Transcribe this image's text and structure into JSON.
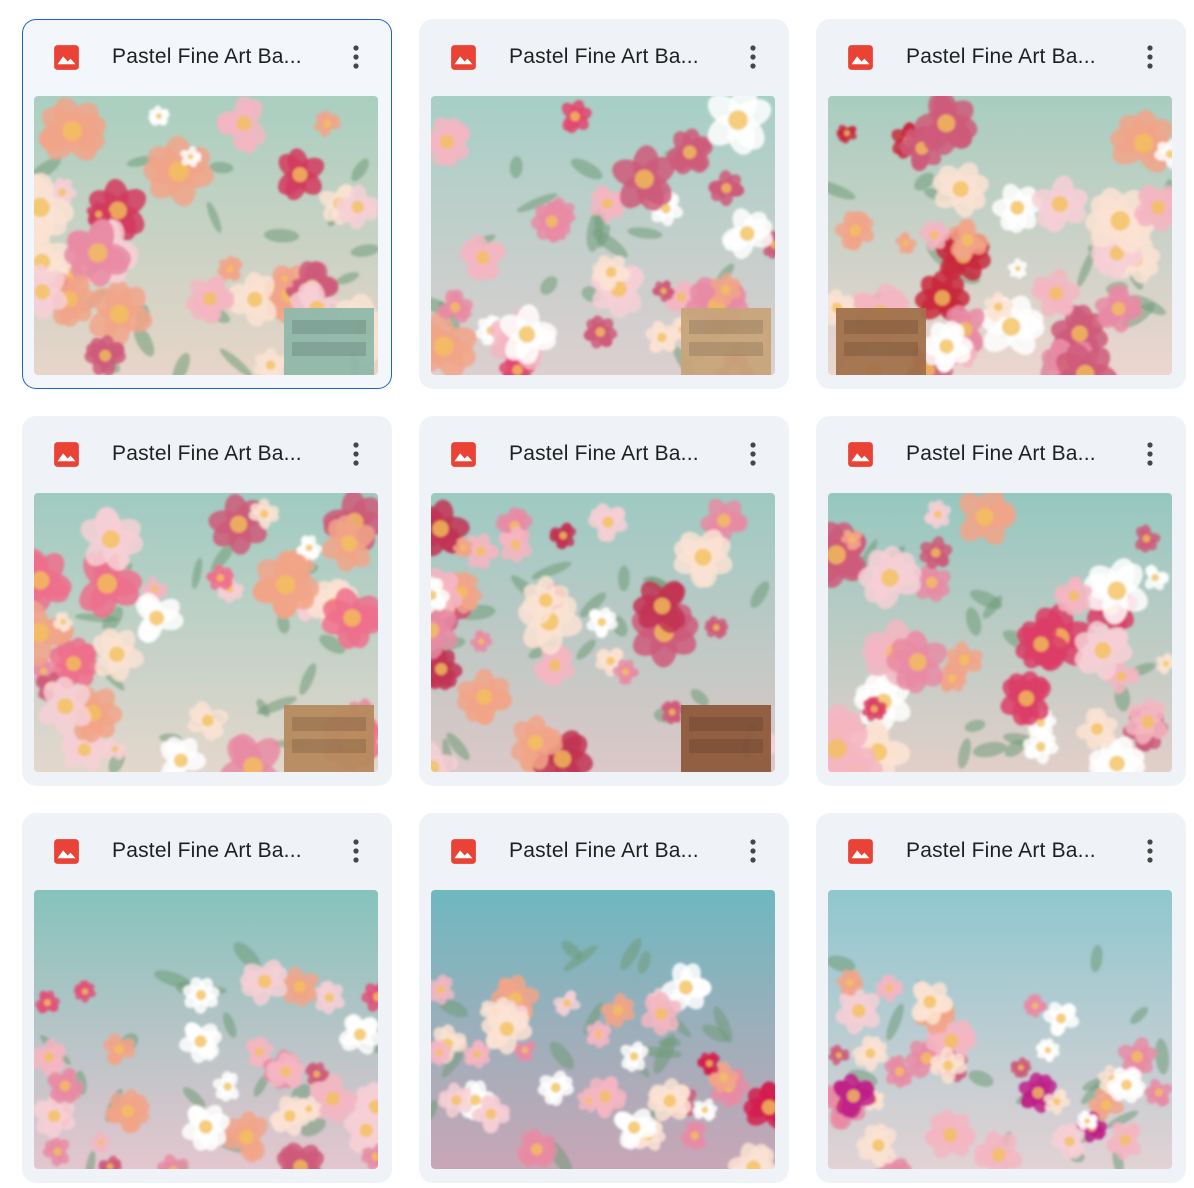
{
  "files": [
    {
      "title": "Pastel Fine Art Ba...",
      "selected": true,
      "bg": [
        "#a9cfc0",
        "#e7d5c8"
      ],
      "accent": "#d43a5e",
      "has_dresser": true,
      "dresser_color": "#8fb8ab"
    },
    {
      "title": "Pastel Fine Art Ba...",
      "selected": false,
      "bg": [
        "#a6cfc6",
        "#ddcfd0"
      ],
      "accent": "#e4456e",
      "has_dresser": true,
      "dresser_color": "#c7a47a"
    },
    {
      "title": "Pastel Fine Art Ba...",
      "selected": false,
      "bg": [
        "#a7cdbf",
        "#ecd6cf"
      ],
      "accent": "#c9283d",
      "has_dresser": true,
      "dresser_color": "#a0714a"
    },
    {
      "title": "Pastel Fine Art Ba...",
      "selected": false,
      "bg": [
        "#9fcbc1",
        "#e4d7cc"
      ],
      "accent": "#ef6f8c",
      "has_dresser": true,
      "dresser_color": "#b68a5e"
    },
    {
      "title": "Pastel Fine Art Ba...",
      "selected": false,
      "bg": [
        "#9dcac2",
        "#dcc8c8"
      ],
      "accent": "#c23454",
      "has_dresser": true,
      "dresser_color": "#8e5a3c"
    },
    {
      "title": "Pastel Fine Art Ba...",
      "selected": false,
      "bg": [
        "#95c8c0",
        "#e2cfc9"
      ],
      "accent": "#dc3d66",
      "has_dresser": false,
      "dresser_color": "#b48556"
    },
    {
      "title": "Pastel Fine Art Ba...",
      "selected": false,
      "bg": [
        "#86c3bd",
        "#e4c6cf"
      ],
      "accent": "#e2507a",
      "has_dresser": false,
      "dresser_color": "#b48556"
    },
    {
      "title": "Pastel Fine Art Ba...",
      "selected": false,
      "bg": [
        "#6eb8c0",
        "#c9a6b6"
      ],
      "accent": "#d41f4e",
      "has_dresser": false,
      "dresser_color": "#b48556"
    },
    {
      "title": "Pastel Fine Art Ba...",
      "selected": false,
      "bg": [
        "#8fc7cf",
        "#e2d2d4"
      ],
      "accent": "#c0208a",
      "has_dresser": false,
      "dresser_color": "#b48556"
    }
  ],
  "icons": {
    "file_type": "image-file-icon",
    "more": "more-vert-icon"
  },
  "colors": {
    "file_icon": "#ea4335",
    "selection_border": "#1f62c9",
    "card_bg": "#eff3f8",
    "title_text": "#1f1f1f"
  }
}
